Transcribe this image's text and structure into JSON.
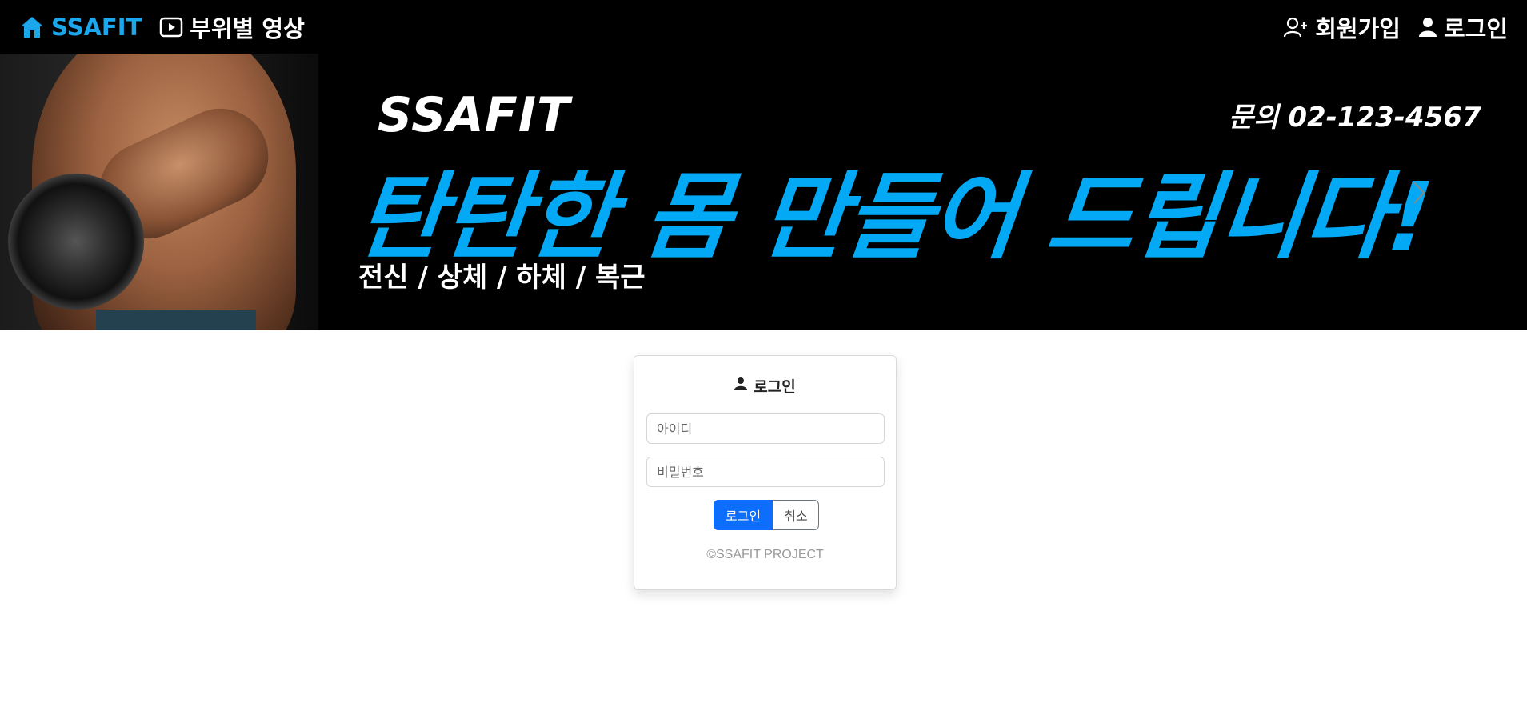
{
  "nav": {
    "brand": "SSAFIT",
    "videos": "부위별 영상",
    "signup": "회원가입",
    "login": "로그인"
  },
  "banner": {
    "brand": "SSAFIT",
    "contact": "문의 02-123-4567",
    "slogan": "탄탄한 몸 만들어 드립니다!",
    "subtitle": "전신 / 상체 / 하체 / 복근"
  },
  "login_card": {
    "title": "로그인",
    "id_placeholder": "아이디",
    "id_value": "",
    "pw_placeholder": "비밀번호",
    "pw_value": "",
    "login_button": "로그인",
    "cancel_button": "취소",
    "footer": "©SSAFIT PROJECT"
  },
  "colors": {
    "brand": "#1aa7ec",
    "slogan": "#03a9f4",
    "primary_button": "#0d6efd",
    "navbar_bg": "#000000"
  },
  "icons": {
    "brand": "home-icon",
    "videos": "play-icon",
    "signup": "person-plus-icon",
    "login": "person-icon",
    "banner_next": "chevron-right-icon"
  }
}
